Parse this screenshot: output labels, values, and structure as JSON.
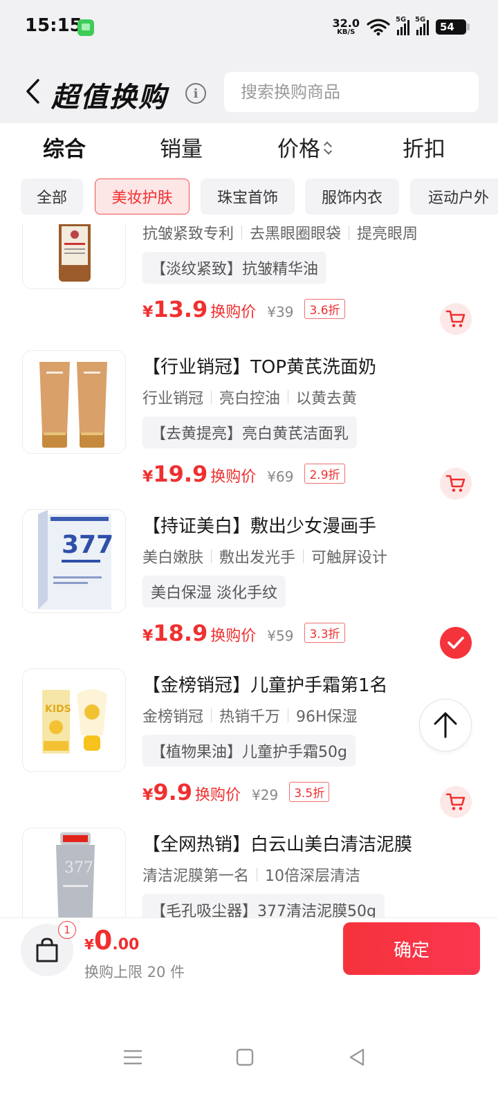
{
  "status_bar": {
    "time": "15:15",
    "net_speed_value": "32.0",
    "net_speed_unit": "KB/S",
    "signal_tag_1": "5G",
    "signal_tag_2": "5G",
    "battery": "54"
  },
  "header": {
    "title": "超值换购",
    "search_placeholder": "搜索换购商品"
  },
  "sort_tabs": [
    {
      "label": "综合",
      "active": true
    },
    {
      "label": "销量",
      "active": false
    },
    {
      "label": "价格",
      "active": false
    },
    {
      "label": "折扣",
      "active": false
    }
  ],
  "categories": [
    {
      "label": "全部",
      "active": false
    },
    {
      "label": "美妆护肤",
      "active": true
    },
    {
      "label": "珠宝首饰",
      "active": false
    },
    {
      "label": "服饰内衣",
      "active": false
    },
    {
      "label": "运动户外",
      "active": false
    }
  ],
  "products": [
    {
      "title": "",
      "tags": [
        "抗皱紧致专利",
        "去黑眼圈眼袋",
        "提亮眼周"
      ],
      "subtitle": "【淡纹紧致】抗皱精华油",
      "yen": "¥",
      "price": "13.9",
      "price_label": "换购价",
      "original_price": "¥39",
      "discount": "3.6折",
      "selected": false
    },
    {
      "title": "【行业销冠】TOP黄芪洗面奶",
      "tags": [
        "行业销冠",
        "亮白控油",
        "以黄去黄"
      ],
      "subtitle": "【去黄提亮】亮白黄芪洁面乳",
      "yen": "¥",
      "price": "19.9",
      "price_label": "换购价",
      "original_price": "¥69",
      "discount": "2.9折",
      "selected": false
    },
    {
      "title": "【持证美白】敷出少女漫画手",
      "tags": [
        "美白嫩肤",
        "敷出发光手",
        "可触屏设计"
      ],
      "subtitle": "美白保湿 淡化手纹",
      "yen": "¥",
      "price": "18.9",
      "price_label": "换购价",
      "original_price": "¥59",
      "discount": "3.3折",
      "selected": true,
      "thumb_text": "377"
    },
    {
      "title": "【金榜销冠】儿童护手霜第1名",
      "tags": [
        "金榜销冠",
        "热销千万",
        "96H保湿"
      ],
      "subtitle": "【植物果油】儿童护手霜50g",
      "yen": "¥",
      "price": "9.9",
      "price_label": "换购价",
      "original_price": "¥29",
      "discount": "3.5折",
      "selected": false,
      "thumb_text": "KIDS"
    },
    {
      "title": "【全网热销】白云山美白清洁泥膜",
      "tags": [
        "清洁泥膜第一名",
        "10倍深层清洁"
      ],
      "subtitle": "【毛孔吸尘器】377清洁泥膜50g",
      "yen": "¥",
      "price": "",
      "price_label": "",
      "original_price": "",
      "discount": "",
      "selected": false,
      "thumb_text": "377"
    }
  ],
  "bottom_bar": {
    "badge_count": "1",
    "total_yen": "¥",
    "total_int": "0",
    "total_dec": ".00",
    "limit_text": "换购上限 20 件",
    "confirm_label": "确定"
  },
  "colors": {
    "accent": "#f02f2f",
    "confirm_bg": "#f5333b",
    "chip_active_bg": "#fde6e6",
    "header_bg": "#f1f1f3"
  }
}
